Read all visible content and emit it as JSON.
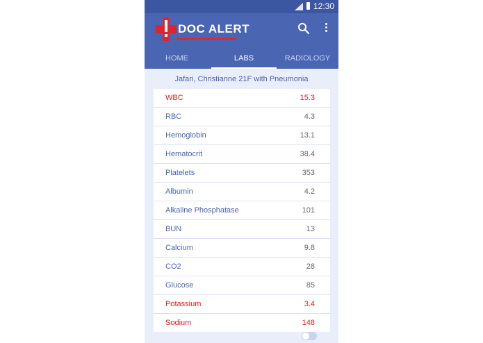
{
  "status_bar": {
    "time": "12:30",
    "icons": [
      "signal-icon",
      "battery-icon"
    ]
  },
  "app_bar": {
    "logo_text": "DOC ALERT",
    "logo_icon": "medical-cross-exclamation-icon",
    "actions": [
      "search-icon",
      "overflow-menu-icon"
    ]
  },
  "tabs": [
    {
      "label": "HOME",
      "active": false
    },
    {
      "label": "LABS",
      "active": true
    },
    {
      "label": "RADIOLOGY",
      "active": false
    }
  ],
  "patient": {
    "header": "Jafari, Christianne 21F with Pneumonia"
  },
  "labs": [
    {
      "name": "WBC",
      "value": "15.3",
      "abnormal": true
    },
    {
      "name": "RBC",
      "value": "4.3",
      "abnormal": false
    },
    {
      "name": "Hemoglobin",
      "value": "13.1",
      "abnormal": false
    },
    {
      "name": "Hematocrit",
      "value": "38.4",
      "abnormal": false
    },
    {
      "name": "Platelets",
      "value": "353",
      "abnormal": false
    },
    {
      "name": "Albumin",
      "value": "4.2",
      "abnormal": false
    },
    {
      "name": "Alkaline Phosphatase",
      "value": "101",
      "abnormal": false
    },
    {
      "name": "BUN",
      "value": "13",
      "abnormal": false
    },
    {
      "name": "Calcium",
      "value": "9.8",
      "abnormal": false
    },
    {
      "name": "CO2",
      "value": "28",
      "abnormal": false
    },
    {
      "name": "Glucose",
      "value": "85",
      "abnormal": false
    },
    {
      "name": "Potassium",
      "value": "3.4",
      "abnormal": true
    },
    {
      "name": "Sodium",
      "value": "148",
      "abnormal": true
    }
  ],
  "colors": {
    "app_bar": "#4a66b3",
    "status_bar": "#3c57a2",
    "background": "#e9eefa",
    "normal_text": "#4a64ad",
    "abnormal_text": "#e01c1c",
    "logo_accent": "#e0242e"
  },
  "toggle": {
    "on": false
  }
}
